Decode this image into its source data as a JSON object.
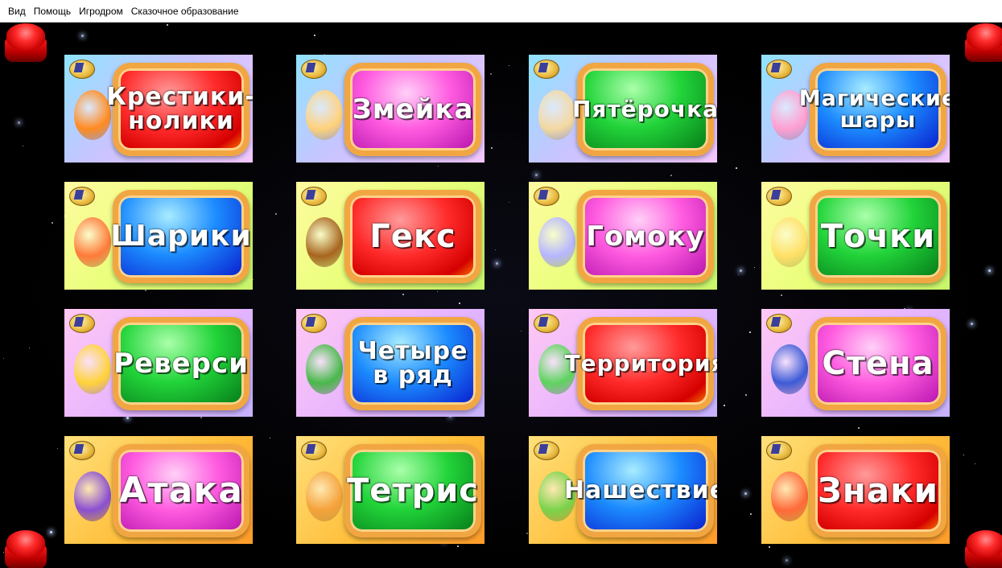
{
  "menu": [
    "Вид",
    "Помощь",
    "Игродром",
    "Сказочное образование"
  ],
  "games": [
    {
      "title": "Крестики-\nнолики",
      "plate": "red",
      "bg": "blue"
    },
    {
      "title": "Змейка",
      "plate": "pink",
      "bg": "blue"
    },
    {
      "title": "Пятёрочка",
      "plate": "green",
      "bg": "blue"
    },
    {
      "title": "Магические\nшары",
      "plate": "blue",
      "bg": "blue"
    },
    {
      "title": "Шарики",
      "plate": "blue",
      "bg": "yellow"
    },
    {
      "title": "Гекс",
      "plate": "red",
      "bg": "yellow"
    },
    {
      "title": "Гомоку",
      "plate": "pink",
      "bg": "yellow"
    },
    {
      "title": "Точки",
      "plate": "green",
      "bg": "yellow"
    },
    {
      "title": "Реверси",
      "plate": "green",
      "bg": "pink"
    },
    {
      "title": "Четыре\nв ряд",
      "plate": "blue",
      "bg": "pink"
    },
    {
      "title": "Территория",
      "plate": "red",
      "bg": "pink"
    },
    {
      "title": "Стена",
      "plate": "pink",
      "bg": "pink"
    },
    {
      "title": "Атака",
      "plate": "pink",
      "bg": "orange"
    },
    {
      "title": "Тетрис",
      "plate": "green",
      "bg": "orange"
    },
    {
      "title": "Нашествие",
      "plate": "blue",
      "bg": "orange"
    },
    {
      "title": "Знаки",
      "plate": "red",
      "bg": "orange"
    }
  ]
}
